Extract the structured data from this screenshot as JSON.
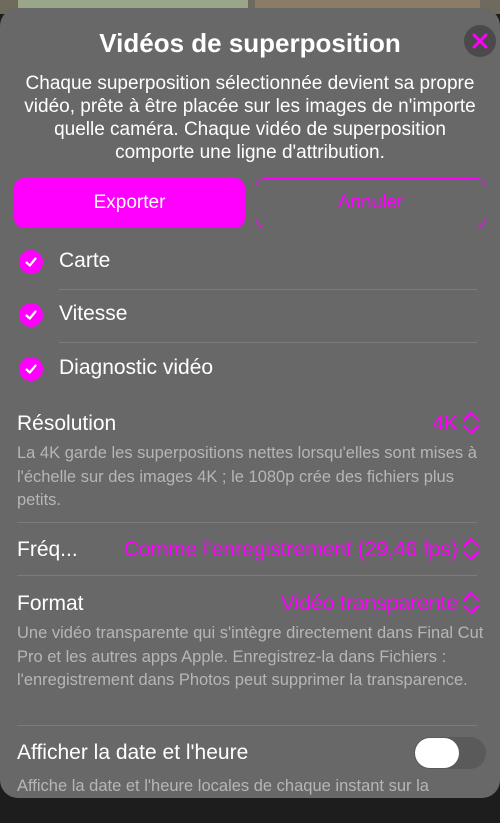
{
  "header": {
    "title": "Vidéos de superposition",
    "subtitle": "Chaque superposition sélectionnée devient sa propre vidéo, prête à être placée sur les images de n'importe quelle caméra. Chaque vidéo de superposition comporte une ligne d'attribution.",
    "close_icon": "close-icon"
  },
  "actions": {
    "export_label": "Exporter",
    "cancel_label": "Annuler"
  },
  "overlays": [
    {
      "label": "Carte",
      "checked": true
    },
    {
      "label": "Vitesse",
      "checked": true
    },
    {
      "label": "Diagnostic vidéo",
      "checked": true
    }
  ],
  "resolution": {
    "label": "Résolution",
    "value": "4K",
    "description": "La 4K garde les superpositions nettes lorsqu'elles sont mises à l'échelle sur des images 4K ; le 1080p crée des fichiers plus petits."
  },
  "frequency": {
    "label": "Fréq...",
    "value": "Comme l'enregistrement (29,46 fps)"
  },
  "format": {
    "label": "Format",
    "value": "Vidéo transparente",
    "description": "Une vidéo transparente qui s'intègre directement dans Final Cut Pro et les autres apps Apple. Enregistrez-la dans Fichiers : l'enregistrement dans Photos peut supprimer la transparence."
  },
  "datetime": {
    "label": "Afficher la date et l'heure",
    "enabled": false,
    "description": "Affiche la date et l'heure locales de chaque instant sur la"
  },
  "colors": {
    "accent": "#ff00ff",
    "sheet": "#686868",
    "secondary_text": "#b6b6b6"
  }
}
